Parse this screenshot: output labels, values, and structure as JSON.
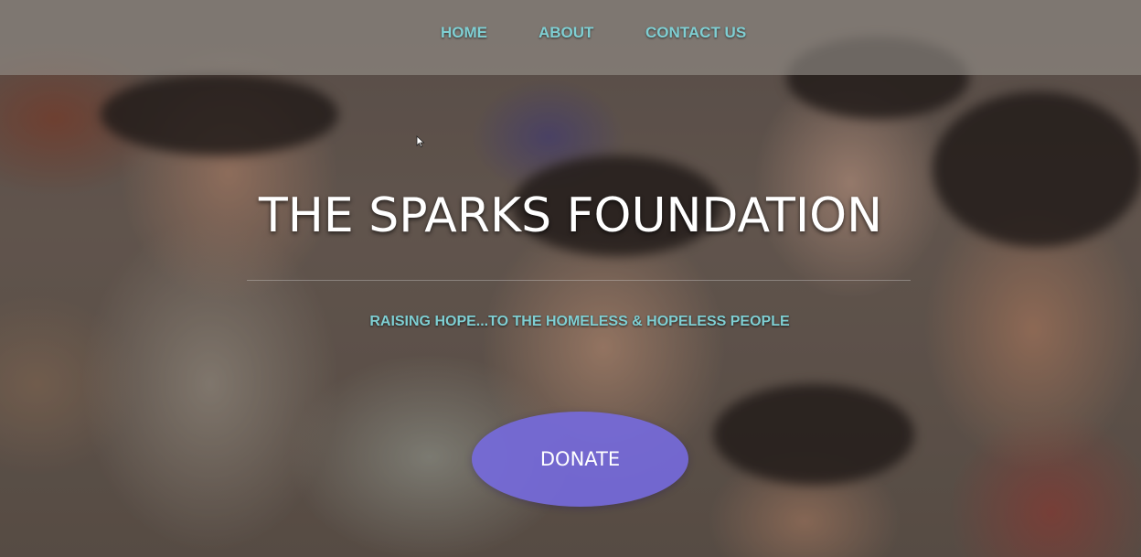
{
  "nav": {
    "items": [
      {
        "label": "HOME"
      },
      {
        "label": "ABOUT"
      },
      {
        "label": "CONTACT US"
      }
    ]
  },
  "hero": {
    "title": "THE SPARKS FOUNDATION",
    "tagline": "RAISING HOPE...TO THE HOMELESS & HOPELESS PEOPLE",
    "donate_label": "DONATE"
  },
  "colors": {
    "nav_text": "#7fcfd3",
    "tagline_text": "#7fcfd3",
    "donate_bg": "#756ade",
    "navbar_bg": "#96918a"
  },
  "icons": {
    "cursor": "mouse-cursor-icon"
  }
}
